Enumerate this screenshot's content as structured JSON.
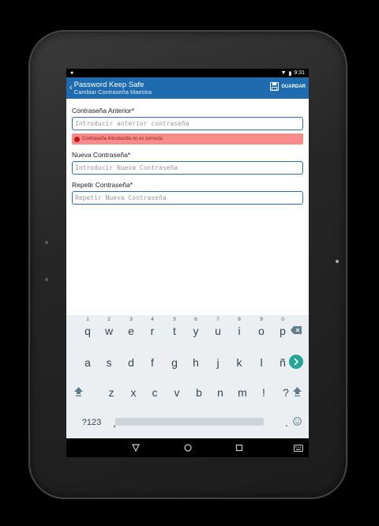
{
  "status": {
    "time": "9:31"
  },
  "appbar": {
    "title": "Password Keep Safe",
    "subtitle": "Cambiar Contraseña Maestra",
    "save_label": "GUARDAR"
  },
  "form": {
    "old_label": "Contraseña Anterior*",
    "old_placeholder": "Introducir anterior contraseña",
    "error": "Contraseña introducida no es correcta",
    "new_label": "Nueva Contraseña*",
    "new_placeholder": "Introducir Nueva Contraseña",
    "repeat_label": "Repetir Contraseña*",
    "repeat_placeholder": "Repetir Nueva Contraseña"
  },
  "keyboard": {
    "row1": [
      {
        "num": "1",
        "ch": "q"
      },
      {
        "num": "2",
        "ch": "w"
      },
      {
        "num": "3",
        "ch": "e"
      },
      {
        "num": "4",
        "ch": "r"
      },
      {
        "num": "5",
        "ch": "t"
      },
      {
        "num": "6",
        "ch": "y"
      },
      {
        "num": "7",
        "ch": "u"
      },
      {
        "num": "8",
        "ch": "i"
      },
      {
        "num": "9",
        "ch": "o"
      },
      {
        "num": "0",
        "ch": "p"
      }
    ],
    "row2": [
      "a",
      "s",
      "d",
      "f",
      "g",
      "h",
      "j",
      "k",
      "l",
      "ñ"
    ],
    "row3": [
      "z",
      "x",
      "c",
      "v",
      "b",
      "n",
      "m",
      "!",
      "?"
    ],
    "sym_label": "?123",
    "comma": ",",
    "period": "."
  },
  "colors": {
    "primary": "#1e6bb0",
    "error_bg": "#f78a8a",
    "error_text": "#c91515",
    "accent": "#26a69a"
  }
}
